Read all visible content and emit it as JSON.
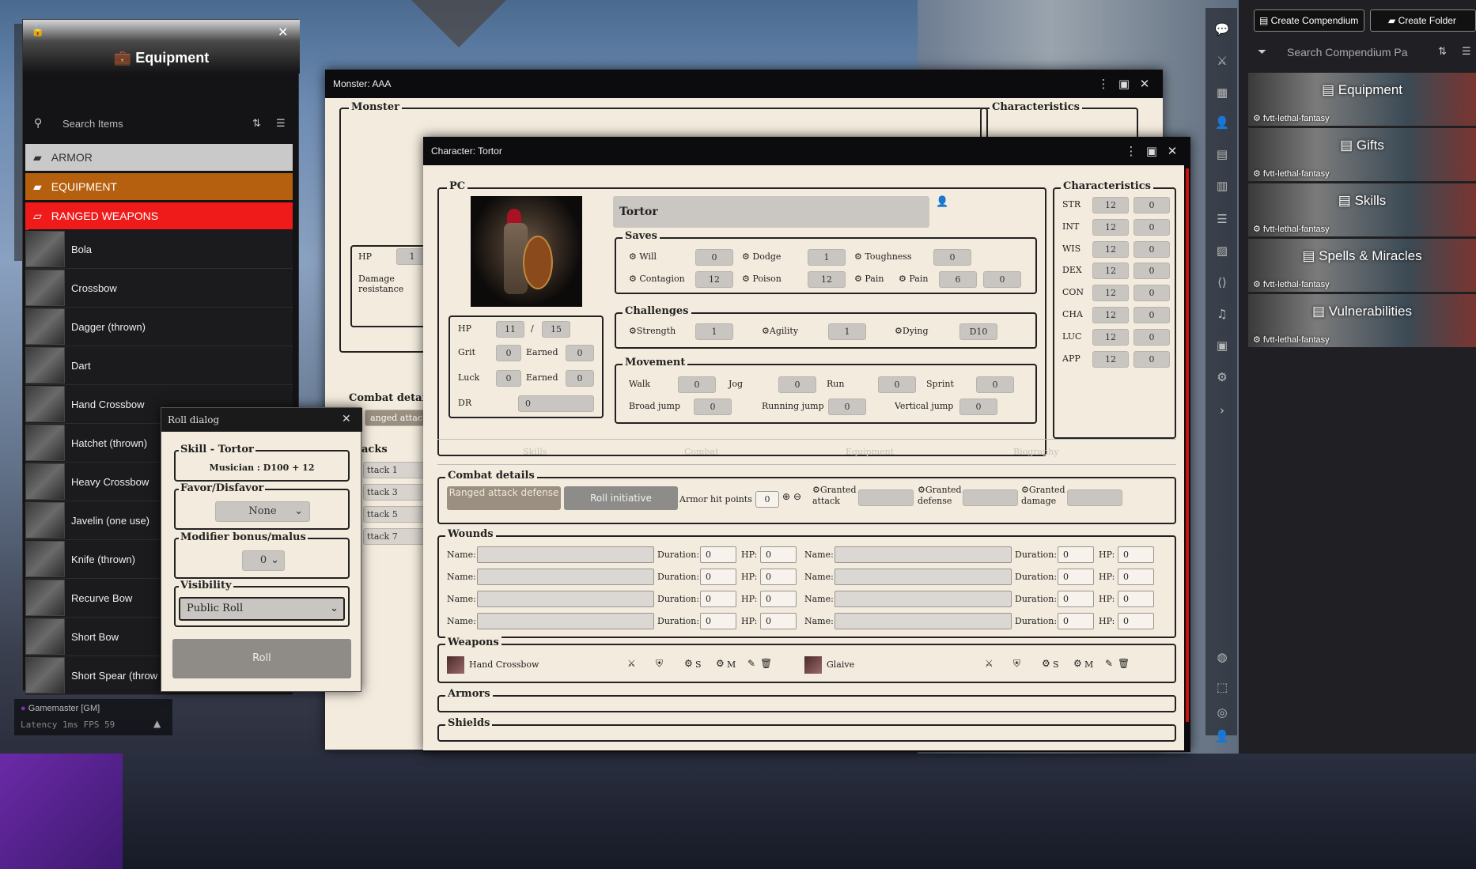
{
  "equipment_panel": {
    "title": "Equipment",
    "search_placeholder": "Search Items",
    "folders": [
      {
        "label": "ARMOR",
        "color": "#c9c9c9"
      },
      {
        "label": "EQUIPMENT",
        "color": "#b5600e"
      },
      {
        "label": "RANGED WEAPONS",
        "color": "#ef1b1b"
      }
    ],
    "items": [
      "Bola",
      "Crossbow",
      "Dagger (thrown)",
      "Dart",
      "Hand Crossbow",
      "Hatchet (thrown)",
      "Heavy Crossbow",
      "Javelin (one use)",
      "Knife (thrown)",
      "Recurve Bow",
      "Short Bow",
      "Short Spear (throw"
    ]
  },
  "status": {
    "user": "Gamemaster [GM]",
    "latency": "Latency  1ms FPS  59",
    "count": "1"
  },
  "monster_window": {
    "title": "Monster: AAA",
    "section": "Monster",
    "characteristics": "Characteristics",
    "hp_label": "HP",
    "hp_value": "1",
    "damage_resistance": "Damage resistance",
    "combat_label": "Combat detai",
    "ranged_attack": "anged attac",
    "attacks_label": "tacks",
    "attacks": [
      "ttack 1",
      "ttack 3",
      "ttack 5",
      "ttack 7"
    ]
  },
  "character_window": {
    "title": "Character: Tortor",
    "pc_legend": "PC",
    "name": "Tortor",
    "hp": {
      "label": "HP",
      "current": "11",
      "sep": "/",
      "max": "15"
    },
    "grit": {
      "label": "Grit",
      "value": "0",
      "earned_label": "Earned",
      "earned": "0"
    },
    "luck": {
      "label": "Luck",
      "value": "0",
      "earned_label": "Earned",
      "earned": "0"
    },
    "dr": {
      "label": "DR",
      "value": "0"
    },
    "saves": {
      "legend": "Saves",
      "row1": [
        {
          "label": "Will",
          "value": "0"
        },
        {
          "label": "Dodge",
          "value": "1"
        },
        {
          "label": "Toughness",
          "value": "0"
        }
      ],
      "row2": [
        {
          "label": "Contagion",
          "value": "12"
        },
        {
          "label": "Poison",
          "value": "12"
        }
      ],
      "pain1": "Pain",
      "pain2": "Pain",
      "pain_a": "6",
      "pain_b": "0"
    },
    "challenges": {
      "legend": "Challenges",
      "items": [
        {
          "label": "Strength",
          "value": "1"
        },
        {
          "label": "Agility",
          "value": "1"
        },
        {
          "label": "Dying",
          "value": "D10"
        }
      ]
    },
    "movement": {
      "legend": "Movement",
      "row1": [
        {
          "label": "Walk",
          "value": "0"
        },
        {
          "label": "Jog",
          "value": "0"
        },
        {
          "label": "Run",
          "value": "0"
        },
        {
          "label": "Sprint",
          "value": "0"
        }
      ],
      "row2": [
        {
          "label": "Broad jump",
          "value": "0"
        },
        {
          "label": "Running jump",
          "value": "0"
        },
        {
          "label": "Vertical jump",
          "value": "0"
        }
      ]
    },
    "characteristics": {
      "legend": "Characteristics",
      "rows": [
        {
          "k": "STR",
          "a": "12",
          "b": "0"
        },
        {
          "k": "INT",
          "a": "12",
          "b": "0"
        },
        {
          "k": "WIS",
          "a": "12",
          "b": "0"
        },
        {
          "k": "DEX",
          "a": "12",
          "b": "0"
        },
        {
          "k": "CON",
          "a": "12",
          "b": "0"
        },
        {
          "k": "CHA",
          "a": "12",
          "b": "0"
        },
        {
          "k": "LUC",
          "a": "12",
          "b": "0"
        },
        {
          "k": "APP",
          "a": "12",
          "b": "0"
        }
      ]
    },
    "tabs": [
      "Skills",
      "Combat",
      "Equipment",
      "Biography"
    ],
    "combat": {
      "legend": "Combat details",
      "ranged_btn": "Ranged attack defense",
      "init_btn": "Roll initiative",
      "armor_label": "Armor hit points",
      "armor_value": "0",
      "granted_attack": "Granted attack",
      "granted_defense": "Granted defense",
      "granted_damage": "Granted damage"
    },
    "wounds": {
      "legend": "Wounds",
      "name_label": "Name:",
      "duration_label": "Duration:",
      "hp_label": "HP:",
      "duration": "0",
      "hp": "0"
    },
    "weapons": {
      "legend": "Weapons",
      "items": [
        {
          "name": "Hand Crossbow"
        },
        {
          "name": "Glaive"
        }
      ],
      "s": "S",
      "m": "M"
    },
    "armors": "Armors",
    "shields": "Shields"
  },
  "roll_dialog": {
    "title": "Roll dialog",
    "skill_legend": "Skill - Tortor",
    "skill_text": "Musician : D100 + 12",
    "favor_legend": "Favor/Disfavor",
    "favor_value": "None",
    "modifier_legend": "Modifier bonus/malus",
    "modifier_value": "0",
    "visibility_legend": "Visibility",
    "visibility_value": "Public Roll",
    "roll_button": "Roll"
  },
  "compendium": {
    "create_compendium": "Create Compendium",
    "create_folder": "Create Folder",
    "search_placeholder": "Search Compendium Pa",
    "packs": [
      {
        "name": "Equipment",
        "tag": "fvtt-lethal-fantasy"
      },
      {
        "name": "Gifts",
        "tag": "fvtt-lethal-fantasy"
      },
      {
        "name": "Skills",
        "tag": "fvtt-lethal-fantasy"
      },
      {
        "name": "Spells & Miracles",
        "tag": "fvtt-lethal-fantasy"
      },
      {
        "name": "Vulnerabilities",
        "tag": "fvtt-lethal-fantasy"
      }
    ]
  }
}
